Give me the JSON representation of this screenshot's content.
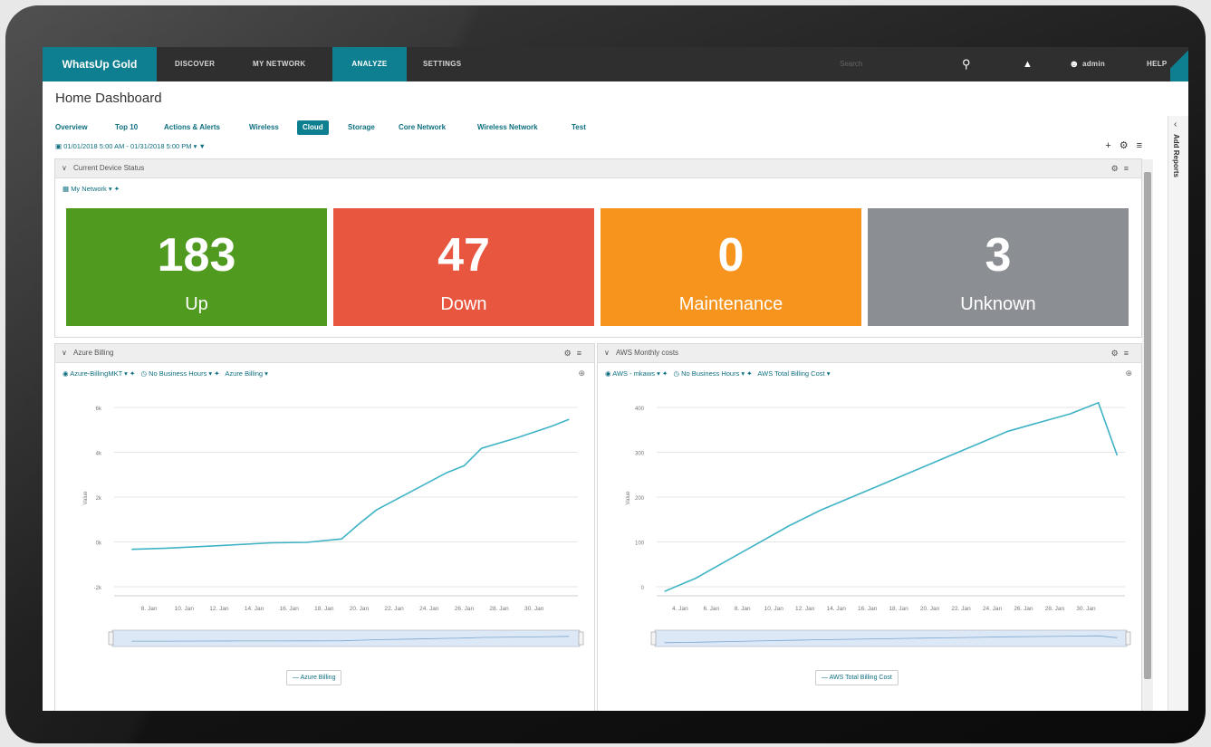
{
  "nav": {
    "brand": "WhatsUp Gold",
    "items": [
      "DISCOVER",
      "MY NETWORK",
      "ANALYZE",
      "SETTINGS"
    ],
    "search_placeholder": "Search",
    "user": "admin",
    "help": "HELP"
  },
  "page_title": "Home Dashboard",
  "tabs": [
    "Overview",
    "Top 10",
    "Actions & Alerts",
    "Wireless",
    "Cloud",
    "Storage",
    "Core Network",
    "Wireless Network",
    "Test"
  ],
  "active_tab": "Cloud",
  "date_range": "01/01/2018 5:00 AM - 01/31/2018 5:00 PM",
  "sidebar_label": "Add Reports",
  "device_status": {
    "title": "Current Device Status",
    "group": "My Network",
    "tiles": [
      {
        "value": "183",
        "label": "Up",
        "color": "#4f9a1f"
      },
      {
        "value": "47",
        "label": "Down",
        "color": "#e8563f"
      },
      {
        "value": "0",
        "label": "Maintenance",
        "color": "#f7941d"
      },
      {
        "value": "3",
        "label": "Unknown",
        "color": "#8b8f93"
      }
    ]
  },
  "azure": {
    "title": "Azure Billing",
    "filters": [
      "Azure-BillingMKT",
      "No Business Hours",
      "Azure Billing"
    ],
    "legend": "Azure Billing"
  },
  "aws": {
    "title": "AWS Monthly costs",
    "filters": [
      "AWS - mkaws",
      "No Business Hours",
      "AWS Total Billing Cost"
    ],
    "legend": "AWS Total Billing Cost"
  },
  "chart_data": [
    {
      "type": "line",
      "title": "Azure Billing",
      "ylabel": "Value",
      "x_tick_labels": [
        "8. Jan",
        "10. Jan",
        "12. Jan",
        "14. Jan",
        "16. Jan",
        "18. Jan",
        "20. Jan",
        "22. Jan",
        "24. Jan",
        "26. Jan",
        "28. Jan",
        "30. Jan"
      ],
      "y_tick_labels": [
        "-2k",
        "0k",
        "2k",
        "4k",
        "6k"
      ],
      "ylim": [
        -2,
        6.5
      ],
      "color": "#3fb3c6",
      "series": [
        {
          "name": "Azure Billing",
          "x": [
            6,
            8,
            10,
            12,
            14,
            16,
            18,
            19,
            20,
            22,
            24,
            25,
            26,
            28,
            30,
            31
          ],
          "y": [
            0.0,
            0.05,
            0.12,
            0.2,
            0.28,
            0.3,
            0.45,
            1.1,
            1.7,
            2.5,
            3.3,
            3.6,
            4.35,
            4.8,
            5.3,
            5.6
          ]
        }
      ]
    },
    {
      "type": "line",
      "title": "AWS Monthly costs",
      "ylabel": "Value",
      "x_tick_labels": [
        "4. Jan",
        "6. Jan",
        "8. Jan",
        "10. Jan",
        "12. Jan",
        "14. Jan",
        "16. Jan",
        "18. Jan",
        "20. Jan",
        "22. Jan",
        "24. Jan",
        "26. Jan",
        "28. Jan",
        "30. Jan"
      ],
      "y_tick_labels": [
        "0",
        "100",
        "200",
        "300",
        "400"
      ],
      "ylim": [
        0,
        450
      ],
      "color": "#3fb3c6",
      "series": [
        {
          "name": "AWS Total Billing Cost",
          "x": [
            2,
            4,
            6,
            8,
            10,
            12,
            14,
            16,
            18,
            20,
            22,
            24,
            26,
            28,
            29.8,
            31
          ],
          "y": [
            10,
            40,
            80,
            120,
            160,
            195,
            225,
            255,
            285,
            315,
            345,
            375,
            395,
            415,
            440,
            320
          ]
        }
      ]
    }
  ]
}
